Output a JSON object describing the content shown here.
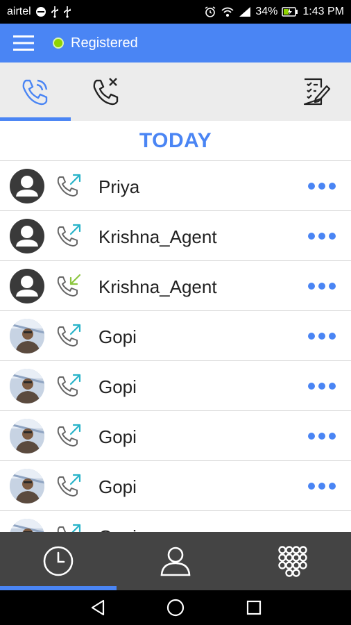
{
  "status_bar": {
    "carrier": "airtel",
    "battery": "34%",
    "time": "1:43 PM"
  },
  "app_bar": {
    "status_label": "Registered",
    "status_color": "#8fd400",
    "accent": "#4a85f4"
  },
  "tabs": [
    {
      "name": "tab-all-calls",
      "icon": "phone-call-icon",
      "selected": true
    },
    {
      "name": "tab-missed-calls",
      "icon": "missed-call-icon",
      "selected": false
    },
    {
      "name": "tab-edit-log",
      "icon": "checklist-edit-icon",
      "selected": false
    }
  ],
  "section": {
    "title": "TODAY"
  },
  "calls": [
    {
      "name": "Priya",
      "direction": "outgoing",
      "avatar": "default"
    },
    {
      "name": "Krishna_Agent",
      "direction": "outgoing",
      "avatar": "default"
    },
    {
      "name": "Krishna_Agent",
      "direction": "incoming",
      "avatar": "default"
    },
    {
      "name": "Gopi",
      "direction": "outgoing",
      "avatar": "photo"
    },
    {
      "name": "Gopi",
      "direction": "outgoing",
      "avatar": "photo"
    },
    {
      "name": "Gopi",
      "direction": "outgoing",
      "avatar": "photo"
    },
    {
      "name": "Gopi",
      "direction": "outgoing",
      "avatar": "photo"
    },
    {
      "name": "Gopi",
      "direction": "outgoing",
      "avatar": "photo"
    }
  ],
  "bottom_nav": [
    {
      "name": "nav-recents",
      "icon": "clock-icon",
      "selected": true
    },
    {
      "name": "nav-contacts",
      "icon": "person-icon",
      "selected": false
    },
    {
      "name": "nav-dialpad",
      "icon": "dialpad-icon",
      "selected": false
    }
  ],
  "colors": {
    "outgoing_arrow": "#27b3c9",
    "incoming_arrow": "#8cc63f"
  }
}
